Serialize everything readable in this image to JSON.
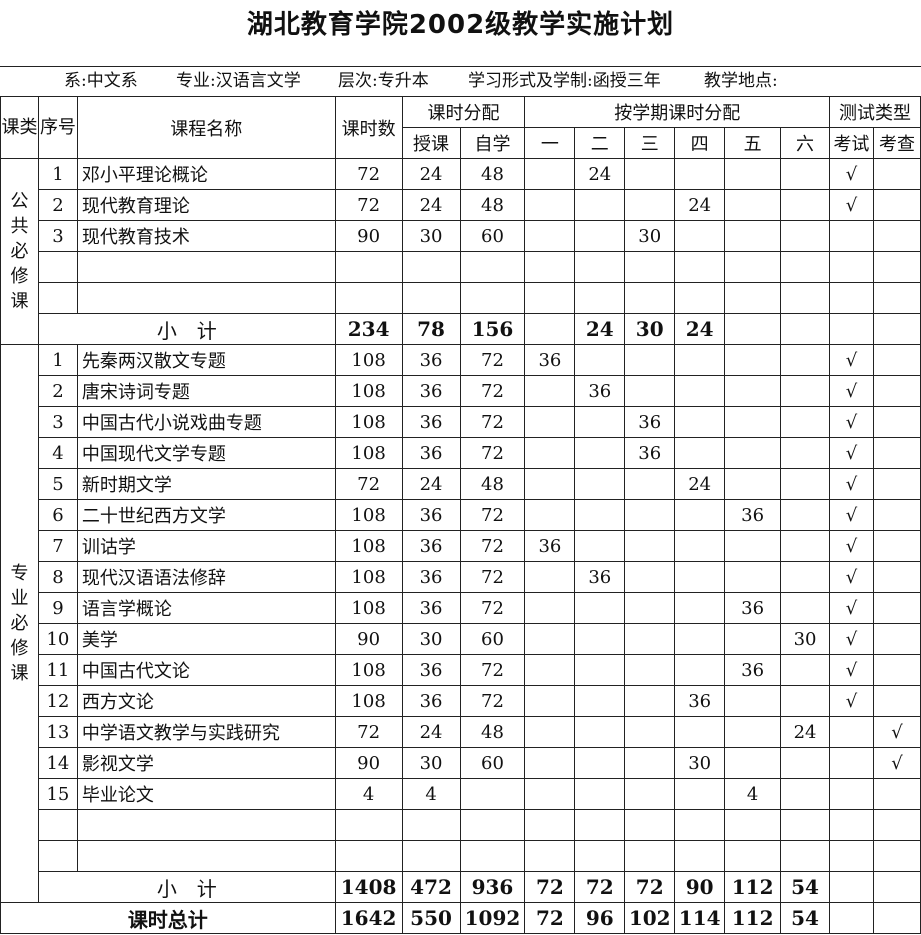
{
  "title": "湖北教育学院2002级教学实施计划",
  "info": {
    "dept": "系:中文系",
    "major": "专业:汉语言文学",
    "level": "层次:专升本",
    "form": "学习形式及学制:函授三年",
    "place": "教学地点:"
  },
  "headers": {
    "category": "课类",
    "seq": "序号",
    "name": "课程名称",
    "hours": "课时数",
    "hour_alloc": "课时分配",
    "lecture": "授课",
    "self": "自学",
    "term_alloc": "按学期课时分配",
    "terms": [
      "一",
      "二",
      "三",
      "四",
      "五",
      "六"
    ],
    "test_type": "测试类型",
    "exam": "考试",
    "check": "考查"
  },
  "groups": [
    {
      "category": "公共必修课",
      "rows": [
        {
          "seq": "1",
          "name": "邓小平理论概论",
          "hours": "72",
          "lecture": "24",
          "self": "48",
          "terms": [
            "",
            "24",
            "",
            "",
            "",
            ""
          ],
          "exam": "√",
          "check": ""
        },
        {
          "seq": "2",
          "name": "现代教育理论",
          "hours": "72",
          "lecture": "24",
          "self": "48",
          "terms": [
            "",
            "",
            "",
            "24",
            "",
            ""
          ],
          "exam": "√",
          "check": ""
        },
        {
          "seq": "3",
          "name": "现代教育技术",
          "hours": "90",
          "lecture": "30",
          "self": "60",
          "terms": [
            "",
            "",
            "30",
            "",
            "",
            ""
          ],
          "exam": "",
          "check": ""
        },
        {
          "seq": "",
          "name": "",
          "hours": "",
          "lecture": "",
          "self": "",
          "terms": [
            "",
            "",
            "",
            "",
            "",
            ""
          ],
          "exam": "",
          "check": ""
        },
        {
          "seq": "",
          "name": "",
          "hours": "",
          "lecture": "",
          "self": "",
          "terms": [
            "",
            "",
            "",
            "",
            "",
            ""
          ],
          "exam": "",
          "check": ""
        }
      ],
      "subtotal": {
        "label": "小　计",
        "hours": "234",
        "lecture": "78",
        "self": "156",
        "terms": [
          "",
          "24",
          "30",
          "24",
          "",
          ""
        ]
      }
    },
    {
      "category": "专业必修课",
      "rows": [
        {
          "seq": "1",
          "name": "先秦两汉散文专题",
          "hours": "108",
          "lecture": "36",
          "self": "72",
          "terms": [
            "36",
            "",
            "",
            "",
            "",
            ""
          ],
          "exam": "√",
          "check": ""
        },
        {
          "seq": "2",
          "name": "唐宋诗词专题",
          "hours": "108",
          "lecture": "36",
          "self": "72",
          "terms": [
            "",
            "36",
            "",
            "",
            "",
            ""
          ],
          "exam": "√",
          "check": ""
        },
        {
          "seq": "3",
          "name": "中国古代小说戏曲专题",
          "hours": "108",
          "lecture": "36",
          "self": "72",
          "terms": [
            "",
            "",
            "36",
            "",
            "",
            ""
          ],
          "exam": "√",
          "check": ""
        },
        {
          "seq": "4",
          "name": "中国现代文学专题",
          "hours": "108",
          "lecture": "36",
          "self": "72",
          "terms": [
            "",
            "",
            "36",
            "",
            "",
            ""
          ],
          "exam": "√",
          "check": ""
        },
        {
          "seq": "5",
          "name": "新时期文学",
          "hours": "72",
          "lecture": "24",
          "self": "48",
          "terms": [
            "",
            "",
            "",
            "24",
            "",
            ""
          ],
          "exam": "√",
          "check": ""
        },
        {
          "seq": "6",
          "name": "二十世纪西方文学",
          "hours": "108",
          "lecture": "36",
          "self": "72",
          "terms": [
            "",
            "",
            "",
            "",
            "36",
            ""
          ],
          "exam": "√",
          "check": ""
        },
        {
          "seq": "7",
          "name": "训诂学",
          "hours": "108",
          "lecture": "36",
          "self": "72",
          "terms": [
            "36",
            "",
            "",
            "",
            "",
            ""
          ],
          "exam": "√",
          "check": ""
        },
        {
          "seq": "8",
          "name": "现代汉语语法修辞",
          "hours": "108",
          "lecture": "36",
          "self": "72",
          "terms": [
            "",
            "36",
            "",
            "",
            "",
            ""
          ],
          "exam": "√",
          "check": ""
        },
        {
          "seq": "9",
          "name": "语言学概论",
          "hours": "108",
          "lecture": "36",
          "self": "72",
          "terms": [
            "",
            "",
            "",
            "",
            "36",
            ""
          ],
          "exam": "√",
          "check": ""
        },
        {
          "seq": "10",
          "name": "美学",
          "hours": "90",
          "lecture": "30",
          "self": "60",
          "terms": [
            "",
            "",
            "",
            "",
            "",
            "30"
          ],
          "exam": "√",
          "check": ""
        },
        {
          "seq": "11",
          "name": "中国古代文论",
          "hours": "108",
          "lecture": "36",
          "self": "72",
          "terms": [
            "",
            "",
            "",
            "",
            "36",
            ""
          ],
          "exam": "√",
          "check": ""
        },
        {
          "seq": "12",
          "name": "西方文论",
          "hours": "108",
          "lecture": "36",
          "self": "72",
          "terms": [
            "",
            "",
            "",
            "36",
            "",
            ""
          ],
          "exam": "√",
          "check": ""
        },
        {
          "seq": "13",
          "name": "中学语文教学与实践研究",
          "hours": "72",
          "lecture": "24",
          "self": "48",
          "terms": [
            "",
            "",
            "",
            "",
            "",
            "24"
          ],
          "exam": "",
          "check": "√"
        },
        {
          "seq": "14",
          "name": "影视文学",
          "hours": "90",
          "lecture": "30",
          "self": "60",
          "terms": [
            "",
            "",
            "",
            "30",
            "",
            ""
          ],
          "exam": "",
          "check": "√"
        },
        {
          "seq": "15",
          "name": "毕业论文",
          "hours": "4",
          "lecture": "4",
          "self": "",
          "terms": [
            "",
            "",
            "",
            "",
            "4",
            ""
          ],
          "exam": "",
          "check": ""
        },
        {
          "seq": "",
          "name": "",
          "hours": "",
          "lecture": "",
          "self": "",
          "terms": [
            "",
            "",
            "",
            "",
            "",
            ""
          ],
          "exam": "",
          "check": ""
        },
        {
          "seq": "",
          "name": "",
          "hours": "",
          "lecture": "",
          "self": "",
          "terms": [
            "",
            "",
            "",
            "",
            "",
            ""
          ],
          "exam": "",
          "check": ""
        }
      ],
      "subtotal": {
        "label": "小　计",
        "hours": "1408",
        "lecture": "472",
        "self": "936",
        "terms": [
          "72",
          "72",
          "72",
          "90",
          "112",
          "54"
        ]
      }
    }
  ],
  "total": {
    "label": "课时总计",
    "hours": "1642",
    "lecture": "550",
    "self": "1092",
    "terms": [
      "72",
      "96",
      "102",
      "114",
      "112",
      "54"
    ]
  }
}
